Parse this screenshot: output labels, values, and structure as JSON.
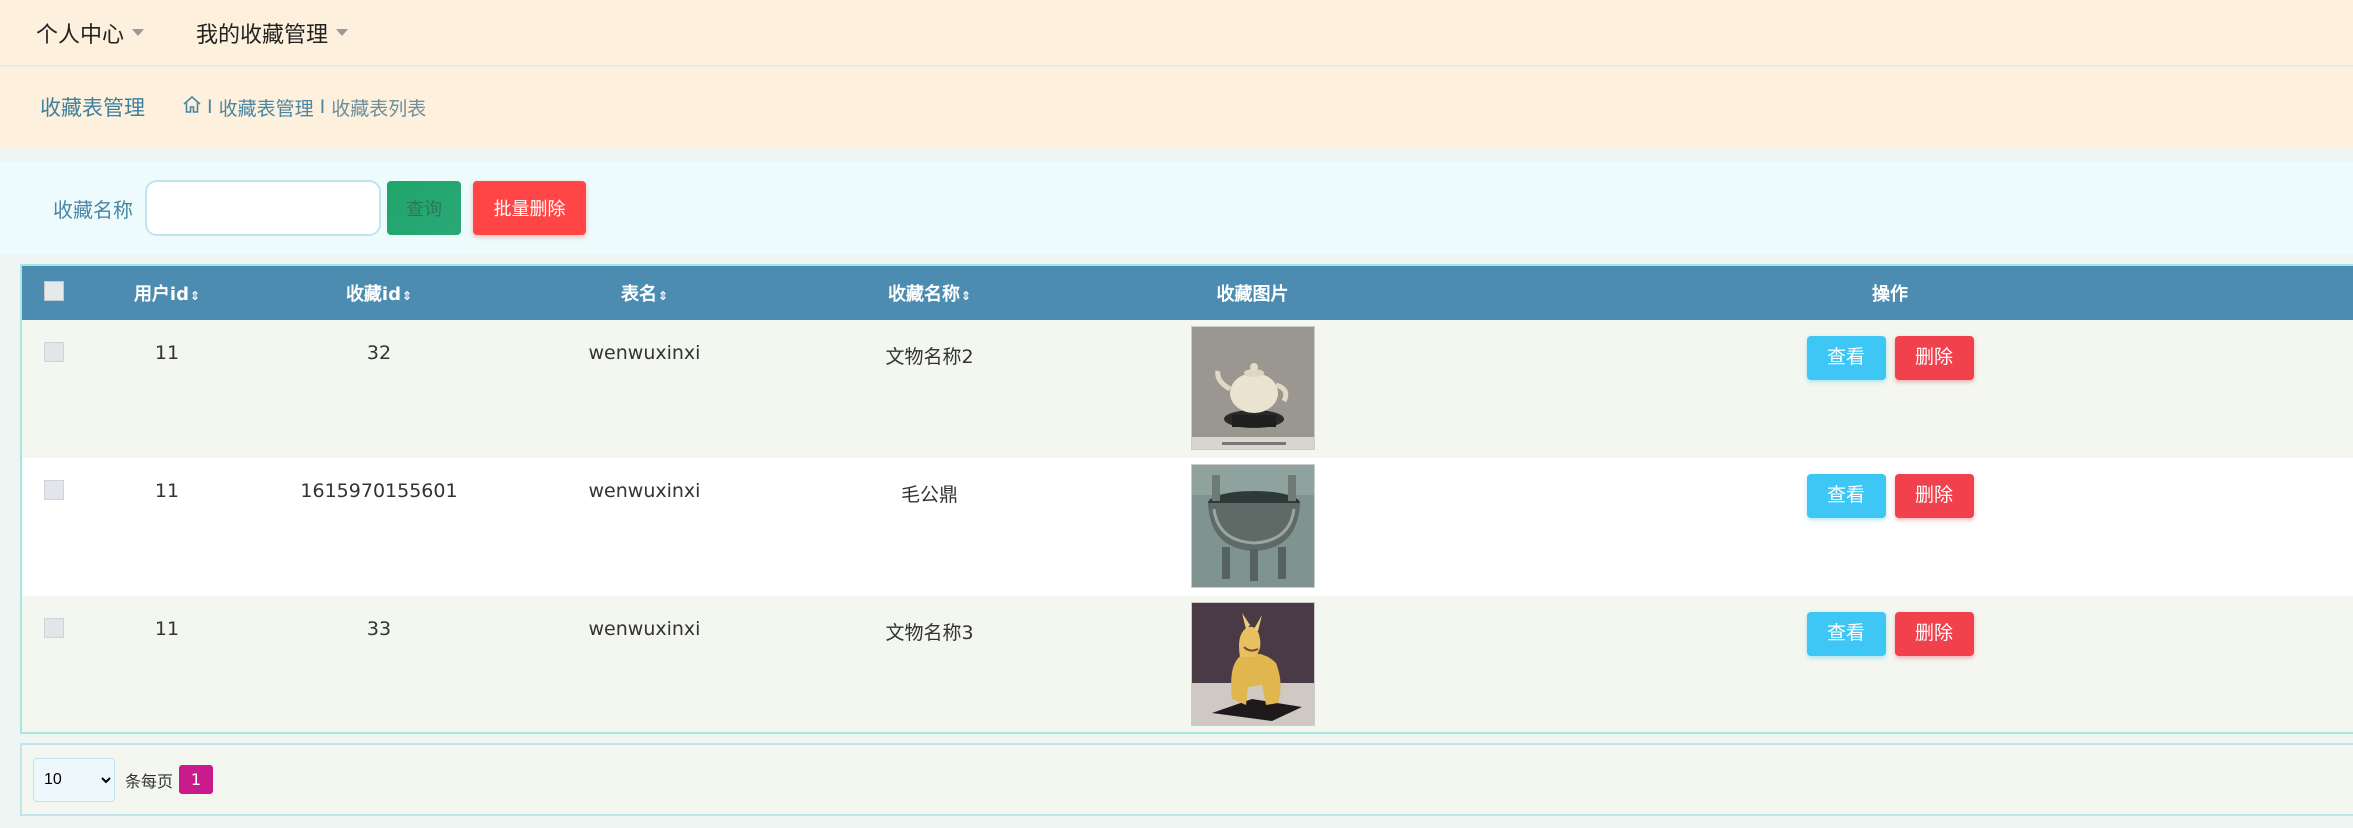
{
  "topnav": {
    "items": [
      {
        "label": "个人中心"
      },
      {
        "label": "我的收藏管理"
      }
    ]
  },
  "breadcrumb": {
    "title": "收藏表管理",
    "sep": "I",
    "path": [
      "收藏表管理",
      "收藏表列表"
    ]
  },
  "search": {
    "label": "收藏名称",
    "value": "",
    "placeholder": "",
    "search_button": "查询",
    "batch_delete_button": "批量删除"
  },
  "table": {
    "columns": [
      "用户id",
      "收藏id",
      "表名",
      "收藏名称",
      "收藏图片",
      "操作"
    ],
    "sortable": [
      true,
      true,
      true,
      true,
      false,
      false
    ],
    "sort_glyph": "⇕",
    "rows": [
      {
        "user_id": "11",
        "fav_id": "32",
        "table_name": "wenwuxinxi",
        "fav_name": "文物名称2",
        "image": "teapot-image"
      },
      {
        "user_id": "11",
        "fav_id": "1615970155601",
        "table_name": "wenwuxinxi",
        "fav_name": "毛公鼎",
        "image": "bronze-ding-image"
      },
      {
        "user_id": "11",
        "fav_id": "33",
        "table_name": "wenwuxinxi",
        "fav_name": "文物名称3",
        "image": "ceramic-figure-image"
      }
    ],
    "view_label": "查看",
    "delete_label": "删除"
  },
  "pager": {
    "page_size": "10",
    "page_size_options": [
      "10"
    ],
    "per_page_label": "条每页",
    "current_page": "1"
  },
  "colors": {
    "header_bg": "#4c8cb1",
    "nav_bg": "#fdf1dd",
    "view_btn": "#3ec6f4",
    "delete_btn": "#f0414d",
    "page_active": "#c91b8c"
  }
}
